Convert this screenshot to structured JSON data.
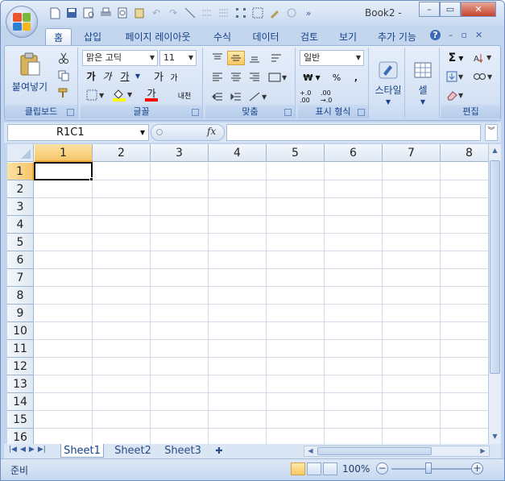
{
  "window": {
    "title": "Book2 -",
    "minimize": "–",
    "maximize": "▭",
    "close": "✕"
  },
  "ribbon_tabs": [
    {
      "label": "홈",
      "active": true
    },
    {
      "label": "삽입"
    },
    {
      "label": "페이지 레이아웃"
    },
    {
      "label": "수식"
    },
    {
      "label": "데이터"
    },
    {
      "label": "검토"
    },
    {
      "label": "보기"
    },
    {
      "label": "추가 기능"
    }
  ],
  "ribbon_right_icons": {
    "help": "?",
    "min": "–",
    "restore": "▫",
    "close": "✕"
  },
  "clipboard": {
    "paste_label": "붙여넣기",
    "group_label": "클립보드"
  },
  "font": {
    "font_name": "맑은 고딕",
    "font_size": "11",
    "bold": "가",
    "italic": "가",
    "underline": "가",
    "grow": "가",
    "shrink": "가",
    "font_color_letter": "가",
    "phonetic": "내천",
    "group_label": "글꼴",
    "fill_color": "#ffff00",
    "text_color": "#ff0000"
  },
  "alignment": {
    "group_label": "맞춤"
  },
  "number": {
    "format": "일반",
    "currency": "₩",
    "percent": "%",
    "comma": ",",
    "inc_decimal": "+.0 .00",
    "dec_decimal": ".00 →.0",
    "group_label": "표시 형식"
  },
  "styles": {
    "label": "스타일"
  },
  "cells": {
    "label": "셀"
  },
  "editing": {
    "group_label": "편집",
    "sum": "Σ"
  },
  "formula_bar": {
    "name_box": "R1C1",
    "fx": "fx",
    "formula": ""
  },
  "grid": {
    "columns": [
      "1",
      "2",
      "3",
      "4",
      "5",
      "6",
      "7",
      "8"
    ],
    "rows": [
      "1",
      "2",
      "3",
      "4",
      "5",
      "6",
      "7",
      "8",
      "9",
      "10",
      "11",
      "12",
      "13",
      "14",
      "15",
      "16"
    ],
    "active_cell": "R1C1"
  },
  "sheet_tabs": [
    {
      "label": "Sheet1",
      "active": true
    },
    {
      "label": "Sheet2"
    },
    {
      "label": "Sheet3"
    }
  ],
  "status_bar": {
    "ready": "준비",
    "zoom": "100%",
    "zoom_minus": "−",
    "zoom_plus": "+"
  },
  "colors": {
    "accent": "#15428b",
    "selected_header": "#f6c66b",
    "ribbon_bg": "#d6e3f5"
  }
}
